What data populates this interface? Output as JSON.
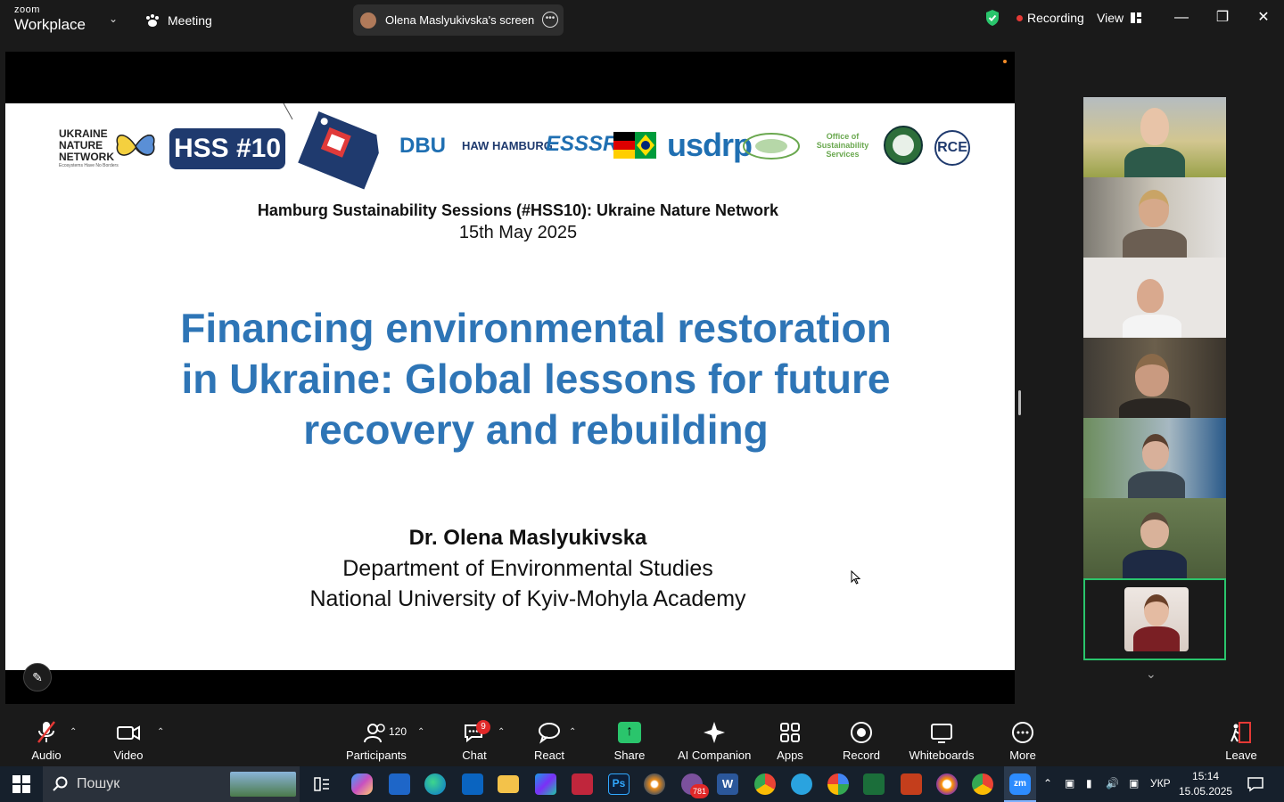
{
  "topbar": {
    "logo_line1": "zoom",
    "logo_line2": "Workplace",
    "meeting_label": "Meeting",
    "share_label": "Olena Maslyukivska's screen",
    "recording_label": "Recording",
    "view_label": "View"
  },
  "slide": {
    "logo_unn": [
      "UKRAINE",
      "NATURE",
      "NETWORK"
    ],
    "logo_unn_sub": "Ecosystems Have No Borders",
    "logo_hss": "HSS #10",
    "partners": [
      "DBU",
      "HAW HAMBURG",
      "ESSSR",
      "usdrp",
      "Office of Sustainability Services",
      "RCE"
    ],
    "subtitle": "Hamburg Sustainability Sessions (#HSS10): Ukraine Nature Network",
    "date": "15th May 2025",
    "title_lines": [
      "Financing environmental restoration",
      "in Ukraine: Global lessons for future",
      "recovery and rebuilding"
    ],
    "author": "Dr. Olena Maslyukivska",
    "department": "Department of Environmental Studies",
    "university": "National University of Kyiv-Mohyla Academy"
  },
  "toolbar": {
    "audio": "Audio",
    "video": "Video",
    "participants": "Participants",
    "participants_count": "120",
    "chat": "Chat",
    "chat_badge": "9",
    "react": "React",
    "share": "Share",
    "ai_companion": "AI Companion",
    "apps": "Apps",
    "record": "Record",
    "whiteboards": "Whiteboards",
    "more": "More",
    "leave": "Leave"
  },
  "taskbar": {
    "search_placeholder": "Пошук",
    "viber_badge": "781",
    "language": "УКР",
    "time": "15:14",
    "date": "15.05.2025"
  },
  "colors": {
    "accent_green": "#2ac56c",
    "title_blue": "#2e75b6",
    "recording_red": "#e53935"
  }
}
